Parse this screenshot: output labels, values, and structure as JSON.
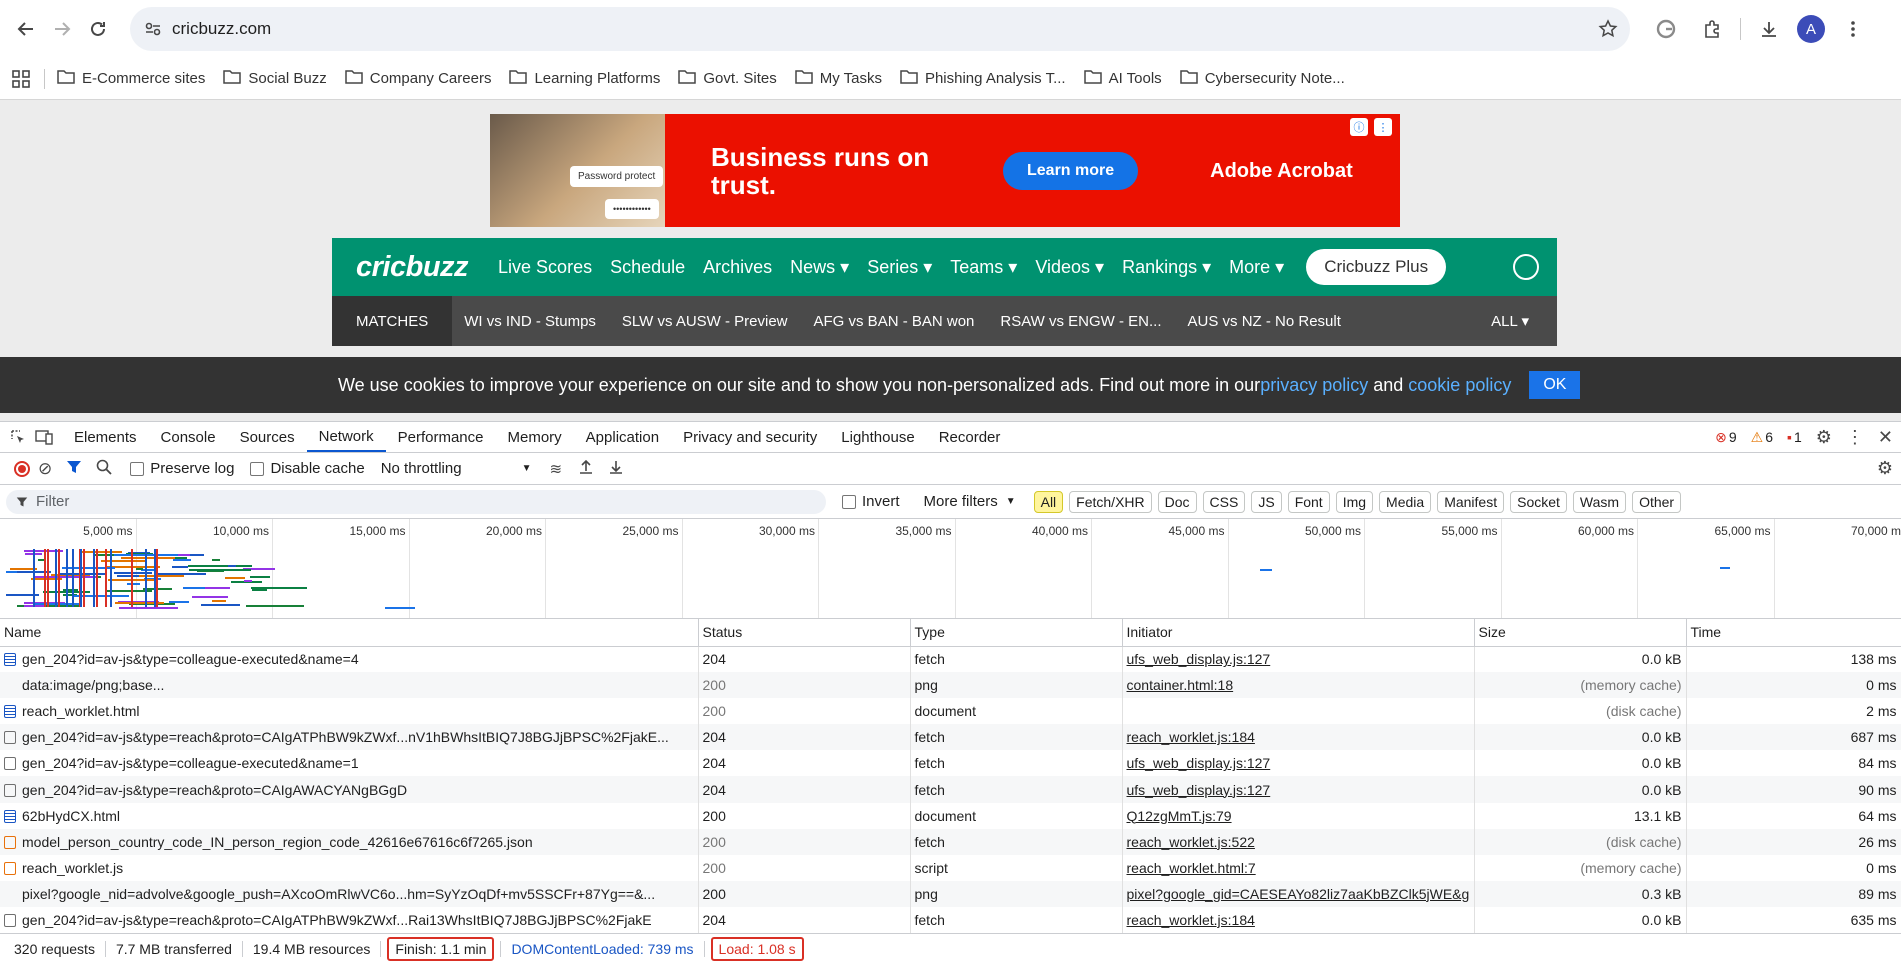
{
  "browser": {
    "url": "cricbuzz.com",
    "profile_initial": "A",
    "bookmarks": [
      "E-Commerce sites",
      "Social Buzz",
      "Company Careers",
      "Learning Platforms",
      "Govt. Sites",
      "My Tasks",
      "Phishing Analysis T...",
      "AI Tools",
      "Cybersecurity Note..."
    ]
  },
  "ad": {
    "headline": "Business runs on trust.",
    "cta": "Learn more",
    "brand": "Adobe Acrobat",
    "pw_label": "Password protect",
    "pw_mask": "••••••••••••"
  },
  "site": {
    "logo": "cricbuzz",
    "nav": [
      "Live Scores",
      "Schedule",
      "Archives",
      "News ▾",
      "Series ▾",
      "Teams ▾",
      "Videos ▾",
      "Rankings ▾",
      "More ▾"
    ],
    "plus": "Cricbuzz Plus",
    "matches_label": "MATCHES",
    "matches": [
      "WI vs IND - Stumps",
      "SLW vs AUSW - Preview",
      "AFG vs BAN - BAN won",
      "RSAW vs ENGW - EN...",
      "AUS vs NZ - No Result"
    ],
    "all_label": "ALL ▾",
    "cookie": {
      "text1": "We use cookies to improve your experience on our site and to show you non-personalized ads. Find out more in our ",
      "link1": "privacy policy",
      "text2": " and ",
      "link2": "cookie policy",
      "ok": "OK"
    }
  },
  "devtools": {
    "tabs": [
      "Elements",
      "Console",
      "Sources",
      "Network",
      "Performance",
      "Memory",
      "Application",
      "Privacy and security",
      "Lighthouse",
      "Recorder"
    ],
    "errors": "9",
    "warnings": "6",
    "issues": "1",
    "preserve_log": "Preserve log",
    "disable_cache": "Disable cache",
    "throttling": "No throttling",
    "filter_placeholder": "Filter",
    "invert": "Invert",
    "more_filters": "More filters",
    "type_filters": [
      "All",
      "Fetch/XHR",
      "Doc",
      "CSS",
      "JS",
      "Font",
      "Img",
      "Media",
      "Manifest",
      "Socket",
      "Wasm",
      "Other"
    ],
    "timeline_ticks": [
      "5,000 ms",
      "10,000 ms",
      "15,000 ms",
      "20,000 ms",
      "25,000 ms",
      "30,000 ms",
      "35,000 ms",
      "40,000 ms",
      "45,000 ms",
      "50,000 ms",
      "55,000 ms",
      "60,000 ms",
      "65,000 ms",
      "70,000 ms"
    ],
    "columns": [
      "Name",
      "Status",
      "Type",
      "Initiator",
      "Size",
      "Time"
    ],
    "rows": [
      {
        "icon": "doc",
        "name": "gen_204?id=av-js&type=colleague-executed&name=4",
        "status": "204",
        "type": "fetch",
        "initiator": "ufs_web_display.js:127",
        "size": "0.0 kB",
        "time": "138 ms",
        "cached": false
      },
      {
        "icon": "none",
        "name": "data:image/png;base...",
        "status": "200",
        "type": "png",
        "initiator": "container.html:18",
        "size": "(memory cache)",
        "time": "0 ms",
        "cached": true
      },
      {
        "icon": "doc",
        "name": "reach_worklet.html",
        "status": "200",
        "type": "document",
        "initiator": "",
        "size": "(disk cache)",
        "time": "2 ms",
        "cached": true
      },
      {
        "icon": "file",
        "name": "gen_204?id=av-js&type=reach&proto=CAIgATPhBW9kZWxf...nV1hBWhsItBIQ7J8BGJjBPSC%2FjakE...",
        "status": "204",
        "type": "fetch",
        "initiator": "reach_worklet.js:184",
        "size": "0.0 kB",
        "time": "687 ms",
        "cached": false
      },
      {
        "icon": "file",
        "name": "gen_204?id=av-js&type=colleague-executed&name=1",
        "status": "204",
        "type": "fetch",
        "initiator": "ufs_web_display.js:127",
        "size": "0.0 kB",
        "time": "84 ms",
        "cached": false
      },
      {
        "icon": "file",
        "name": "gen_204?id=av-js&type=reach&proto=CAIgAWACYANgBGgD",
        "status": "204",
        "type": "fetch",
        "initiator": "ufs_web_display.js:127",
        "size": "0.0 kB",
        "time": "90 ms",
        "cached": false
      },
      {
        "icon": "doc",
        "name": "62bHydCX.html",
        "status": "200",
        "type": "document",
        "initiator": "Q12zgMmT.js:79",
        "size": "13.1 kB",
        "time": "64 ms",
        "cached": false
      },
      {
        "icon": "js",
        "name": "model_person_country_code_IN_person_region_code_42616e67616c6f7265.json",
        "status": "200",
        "type": "fetch",
        "initiator": "reach_worklet.js:522",
        "size": "(disk cache)",
        "time": "26 ms",
        "cached": true
      },
      {
        "icon": "js",
        "name": "reach_worklet.js",
        "status": "200",
        "type": "script",
        "initiator": "reach_worklet.html:7",
        "size": "(memory cache)",
        "time": "0 ms",
        "cached": true
      },
      {
        "icon": "none",
        "name": "pixel?google_nid=advolve&google_push=AXcoOmRlwVC6o...hm=SyYzOqDf+mv5SSCFr+87Yg==&...",
        "status": "200",
        "type": "png",
        "initiator": "pixel?google_gid=CAESEAYo82liz7aaKbBZClk5jWE&g",
        "size": "0.3 kB",
        "time": "89 ms",
        "cached": false
      },
      {
        "icon": "file",
        "name": "gen_204?id=av-js&type=reach&proto=CAIgATPhBW9kZWxf...Rai13WhsItBIQ7J8BGJjBPSC%2FjakE",
        "status": "204",
        "type": "fetch",
        "initiator": "reach_worklet.js:184",
        "size": "0.0 kB",
        "time": "635 ms",
        "cached": false
      }
    ],
    "summary": {
      "requests": "320 requests",
      "transferred": "7.7 MB transferred",
      "resources": "19.4 MB resources",
      "finish": "Finish: 1.1 min",
      "dcl": "DOMContentLoaded: 739 ms",
      "load": "Load: 1.08 s"
    },
    "colors": {
      "accent": "#0b57d0",
      "error": "#d93025",
      "dcl": "#1a56c4",
      "load": "#d93025"
    }
  }
}
